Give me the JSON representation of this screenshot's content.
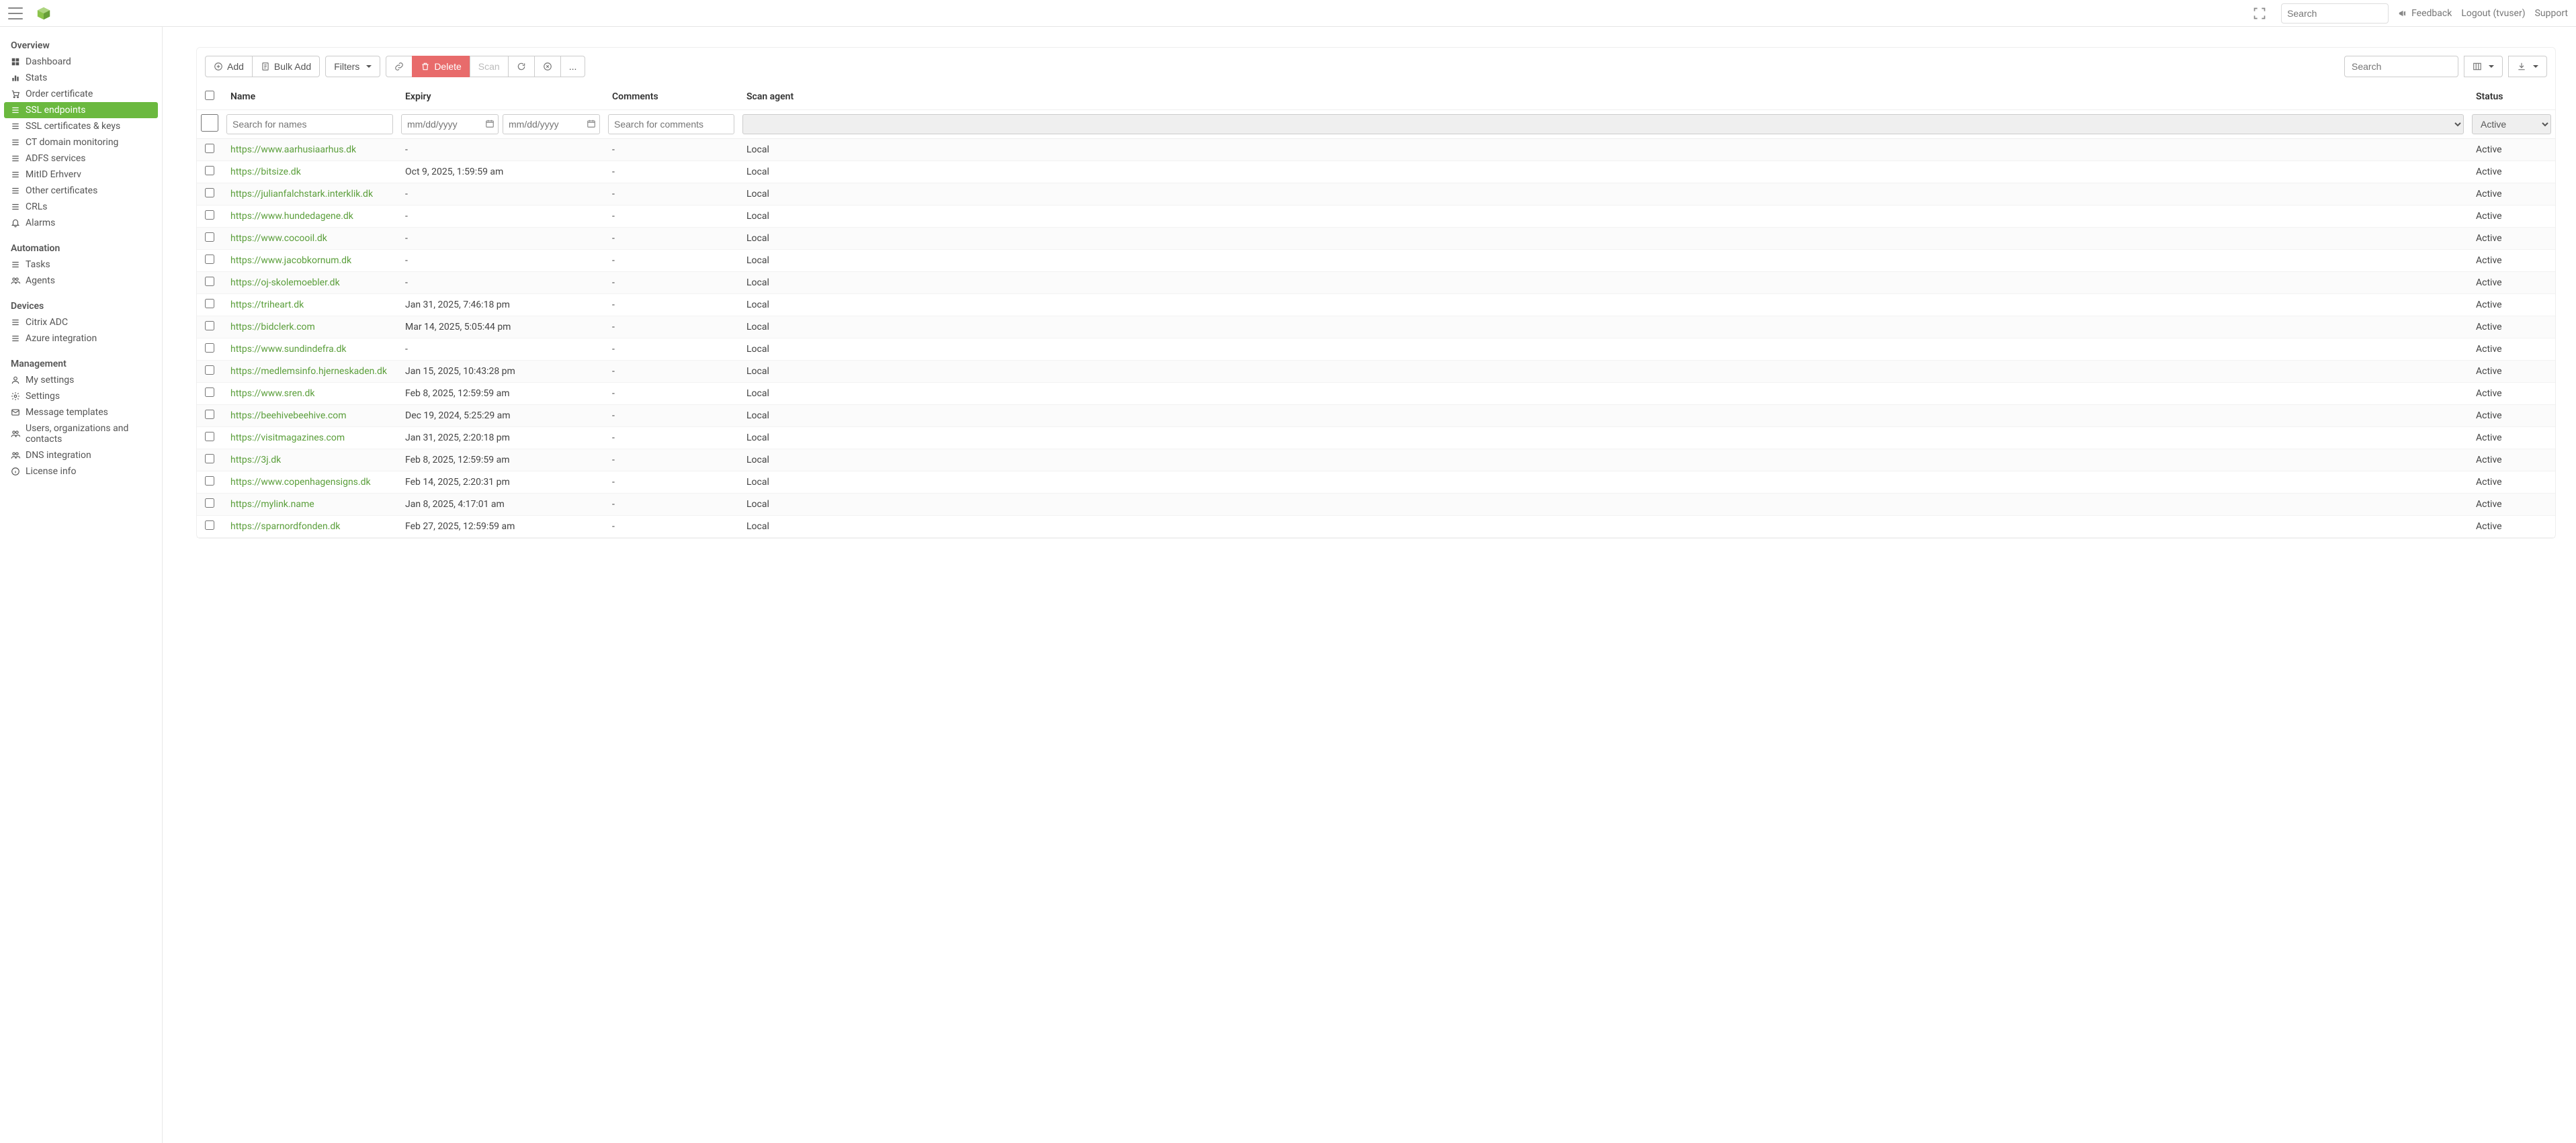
{
  "header": {
    "search_placeholder": "Search",
    "feedback": "Feedback",
    "logout": "Logout (tvuser)",
    "support": "Support"
  },
  "sidebar": {
    "sections": [
      {
        "title": "Overview",
        "items": [
          {
            "label": "Dashboard",
            "icon": "dashboard"
          },
          {
            "label": "Stats",
            "icon": "stats"
          },
          {
            "label": "Order certificate",
            "icon": "cart"
          },
          {
            "label": "SSL endpoints",
            "icon": "list",
            "active": true
          },
          {
            "label": "SSL certificates & keys",
            "icon": "list"
          },
          {
            "label": "CT domain monitoring",
            "icon": "list"
          },
          {
            "label": "ADFS services",
            "icon": "list"
          },
          {
            "label": "MitID Erhverv",
            "icon": "list"
          },
          {
            "label": "Other certificates",
            "icon": "list"
          },
          {
            "label": "CRLs",
            "icon": "list"
          },
          {
            "label": "Alarms",
            "icon": "bell"
          }
        ]
      },
      {
        "title": "Automation",
        "items": [
          {
            "label": "Tasks",
            "icon": "list"
          },
          {
            "label": "Agents",
            "icon": "users"
          }
        ]
      },
      {
        "title": "Devices",
        "items": [
          {
            "label": "Citrix ADC",
            "icon": "list"
          },
          {
            "label": "Azure integration",
            "icon": "list"
          }
        ]
      },
      {
        "title": "Management",
        "items": [
          {
            "label": "My settings",
            "icon": "user"
          },
          {
            "label": "Settings",
            "icon": "gear"
          },
          {
            "label": "Message templates",
            "icon": "mail"
          },
          {
            "label": "Users, organizations and contacts",
            "icon": "users"
          },
          {
            "label": "DNS integration",
            "icon": "users"
          },
          {
            "label": "License info",
            "icon": "info"
          }
        ]
      }
    ]
  },
  "toolbar": {
    "add": "Add",
    "bulk_add": "Bulk Add",
    "filters": "Filters",
    "delete": "Delete",
    "scan": "Scan",
    "more": "...",
    "search_placeholder": "Search"
  },
  "columns": {
    "name": "Name",
    "expiry": "Expiry",
    "comments": "Comments",
    "scan_agent": "Scan agent",
    "status": "Status"
  },
  "filters": {
    "name_placeholder": "Search for names",
    "date_placeholder": "mm/dd/yyyy",
    "comments_placeholder": "Search for comments",
    "status_value": "Active"
  },
  "rows": [
    {
      "name": "https://www.aarhusiaarhus.dk",
      "expiry": "-",
      "comments": "-",
      "agent": "Local",
      "status": "Active"
    },
    {
      "name": "https://bitsize.dk",
      "expiry": "Oct 9, 2025, 1:59:59 am",
      "comments": "-",
      "agent": "Local",
      "status": "Active"
    },
    {
      "name": "https://julianfalchstark.interklik.dk",
      "expiry": "-",
      "comments": "-",
      "agent": "Local",
      "status": "Active"
    },
    {
      "name": "https://www.hundedagene.dk",
      "expiry": "-",
      "comments": "-",
      "agent": "Local",
      "status": "Active"
    },
    {
      "name": "https://www.cocooil.dk",
      "expiry": "-",
      "comments": "-",
      "agent": "Local",
      "status": "Active"
    },
    {
      "name": "https://www.jacobkornum.dk",
      "expiry": "-",
      "comments": "-",
      "agent": "Local",
      "status": "Active"
    },
    {
      "name": "https://oj-skolemoebler.dk",
      "expiry": "-",
      "comments": "-",
      "agent": "Local",
      "status": "Active"
    },
    {
      "name": "https://triheart.dk",
      "expiry": "Jan 31, 2025, 7:46:18 pm",
      "comments": "-",
      "agent": "Local",
      "status": "Active"
    },
    {
      "name": "https://bidclerk.com",
      "expiry": "Mar 14, 2025, 5:05:44 pm",
      "comments": "-",
      "agent": "Local",
      "status": "Active"
    },
    {
      "name": "https://www.sundindefra.dk",
      "expiry": "-",
      "comments": "-",
      "agent": "Local",
      "status": "Active"
    },
    {
      "name": "https://medlemsinfo.hjerneskaden.dk",
      "expiry": "Jan 15, 2025, 10:43:28 pm",
      "comments": "-",
      "agent": "Local",
      "status": "Active"
    },
    {
      "name": "https://www.sren.dk",
      "expiry": "Feb 8, 2025, 12:59:59 am",
      "comments": "-",
      "agent": "Local",
      "status": "Active"
    },
    {
      "name": "https://beehivebeehive.com",
      "expiry": "Dec 19, 2024, 5:25:29 am",
      "comments": "-",
      "agent": "Local",
      "status": "Active"
    },
    {
      "name": "https://visitmagazines.com",
      "expiry": "Jan 31, 2025, 2:20:18 pm",
      "comments": "-",
      "agent": "Local",
      "status": "Active"
    },
    {
      "name": "https://3j.dk",
      "expiry": "Feb 8, 2025, 12:59:59 am",
      "comments": "-",
      "agent": "Local",
      "status": "Active"
    },
    {
      "name": "https://www.copenhagensigns.dk",
      "expiry": "Feb 14, 2025, 2:20:31 pm",
      "comments": "-",
      "agent": "Local",
      "status": "Active"
    },
    {
      "name": "https://mylink.name",
      "expiry": "Jan 8, 2025, 4:17:01 am",
      "comments": "-",
      "agent": "Local",
      "status": "Active"
    },
    {
      "name": "https://sparnordfonden.dk",
      "expiry": "Feb 27, 2025, 12:59:59 am",
      "comments": "-",
      "agent": "Local",
      "status": "Active"
    }
  ]
}
